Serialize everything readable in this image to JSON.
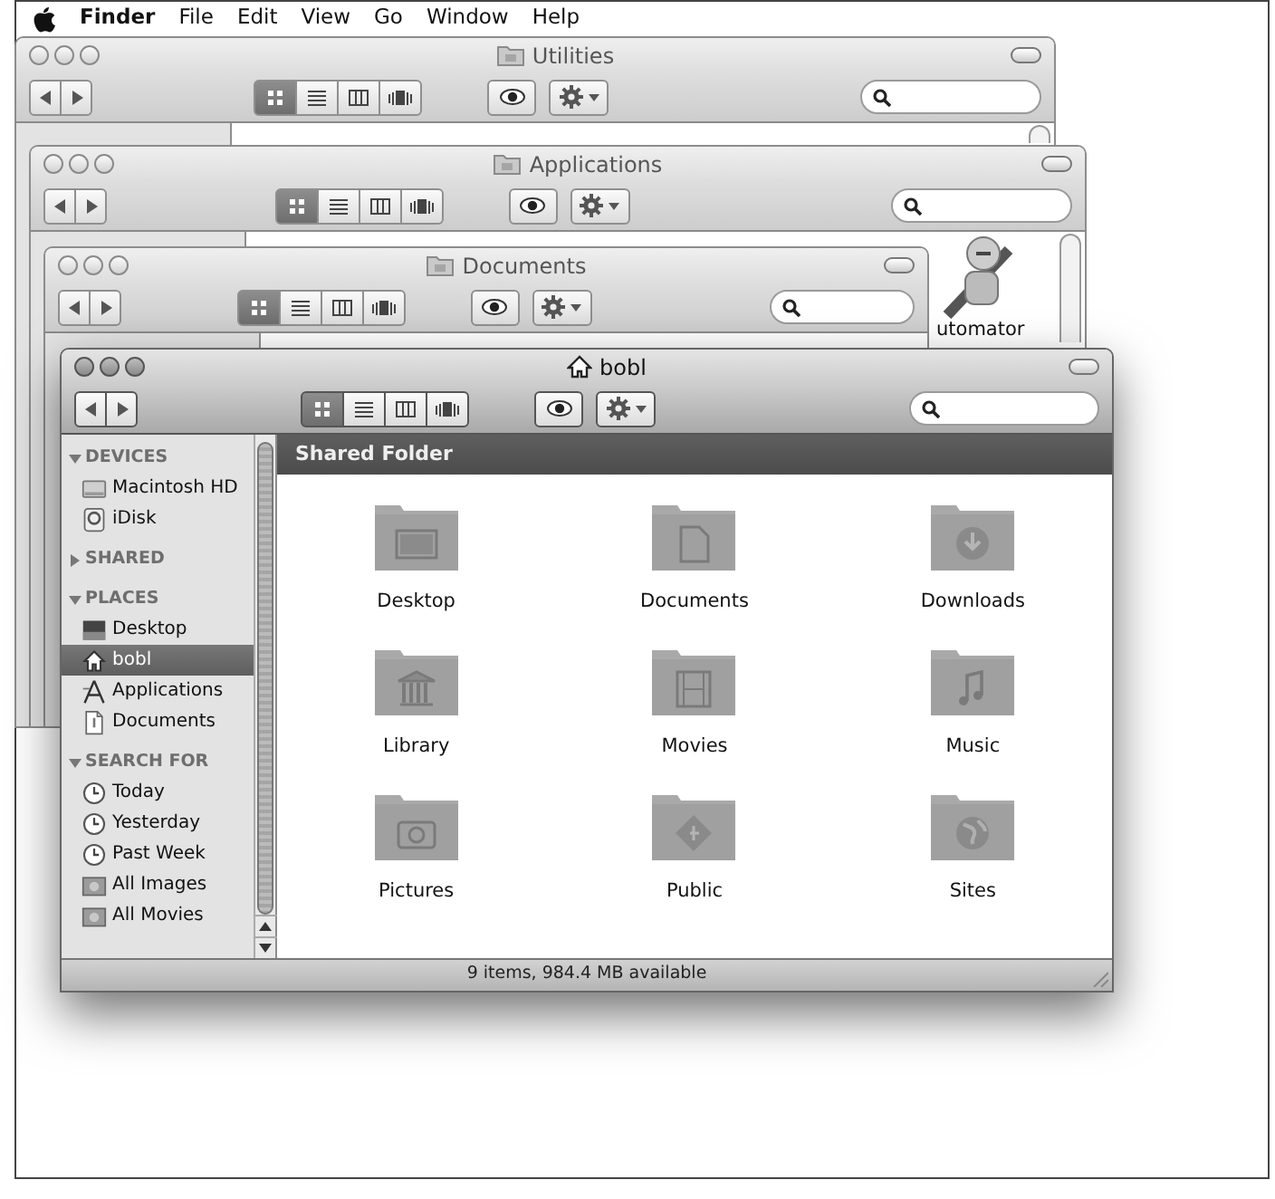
{
  "menu_bar": {
    "app_name": "Finder",
    "menus": [
      "File",
      "Edit",
      "View",
      "Go",
      "Window",
      "Help"
    ]
  },
  "windows": [
    {
      "title": "Utilities",
      "kind": "folder",
      "active": false,
      "view_modes": [
        {
          "kind": "icons",
          "selected": true
        },
        {
          "kind": "list",
          "selected": false
        },
        {
          "kind": "columns",
          "selected": false
        },
        {
          "kind": "cover_flow",
          "selected": false
        }
      ]
    },
    {
      "title": "Applications",
      "kind": "folder",
      "active": false,
      "view_modes": [
        {
          "kind": "icons",
          "selected": true
        },
        {
          "kind": "list",
          "selected": false
        },
        {
          "kind": "columns",
          "selected": false
        },
        {
          "kind": "cover_flow",
          "selected": false
        }
      ],
      "items": [
        {
          "label": "utomator",
          "kind": "robot"
        }
      ]
    },
    {
      "title": "Documents",
      "kind": "folder",
      "active": false,
      "view_modes": [
        {
          "kind": "icons",
          "selected": true
        },
        {
          "kind": "list",
          "selected": false
        },
        {
          "kind": "columns",
          "selected": false
        },
        {
          "kind": "cover_flow",
          "selected": false
        }
      ]
    },
    {
      "title": "bobl",
      "kind": "home",
      "active": true,
      "view_modes": [
        {
          "kind": "icons",
          "selected": true
        },
        {
          "kind": "list",
          "selected": false
        },
        {
          "kind": "columns",
          "selected": false
        },
        {
          "kind": "cover_flow",
          "selected": false
        }
      ],
      "sidebar": [
        {
          "label": "DEVICES",
          "expanded": true,
          "items": [
            {
              "label": "Macintosh HD",
              "kind": "drive",
              "selected": false
            },
            {
              "label": "iDisk",
              "kind": "idisk",
              "selected": false
            }
          ]
        },
        {
          "label": "SHARED",
          "expanded": false
        },
        {
          "label": "PLACES",
          "expanded": true,
          "items": [
            {
              "label": "Desktop",
              "kind": "desktop",
              "selected": false
            },
            {
              "label": "bobl",
              "kind": "home",
              "selected": true
            },
            {
              "label": "Applications",
              "kind": "apps",
              "selected": false
            },
            {
              "label": "Documents",
              "kind": "document",
              "selected": false
            }
          ]
        },
        {
          "label": "SEARCH FOR",
          "expanded": true,
          "items": [
            {
              "label": "Today",
              "kind": "clock",
              "selected": false
            },
            {
              "label": "Yesterday",
              "kind": "clock",
              "selected": false
            },
            {
              "label": "Past Week",
              "kind": "clock",
              "selected": false
            },
            {
              "label": "All Images",
              "kind": "smart",
              "selected": false
            },
            {
              "label": "All Movies",
              "kind": "smart",
              "selected": false
            }
          ]
        }
      ],
      "header": "Shared Folder",
      "items": [
        {
          "label": "Desktop",
          "kind": "desktop"
        },
        {
          "label": "Documents",
          "kind": "documents"
        },
        {
          "label": "Downloads",
          "kind": "downloads"
        },
        {
          "label": "Library",
          "kind": "library"
        },
        {
          "label": "Movies",
          "kind": "movies"
        },
        {
          "label": "Music",
          "kind": "music"
        },
        {
          "label": "Pictures",
          "kind": "pictures"
        },
        {
          "label": "Public",
          "kind": "public"
        },
        {
          "label": "Sites",
          "kind": "sites"
        }
      ],
      "status_bar": "9 items, 984.4 MB available"
    }
  ]
}
